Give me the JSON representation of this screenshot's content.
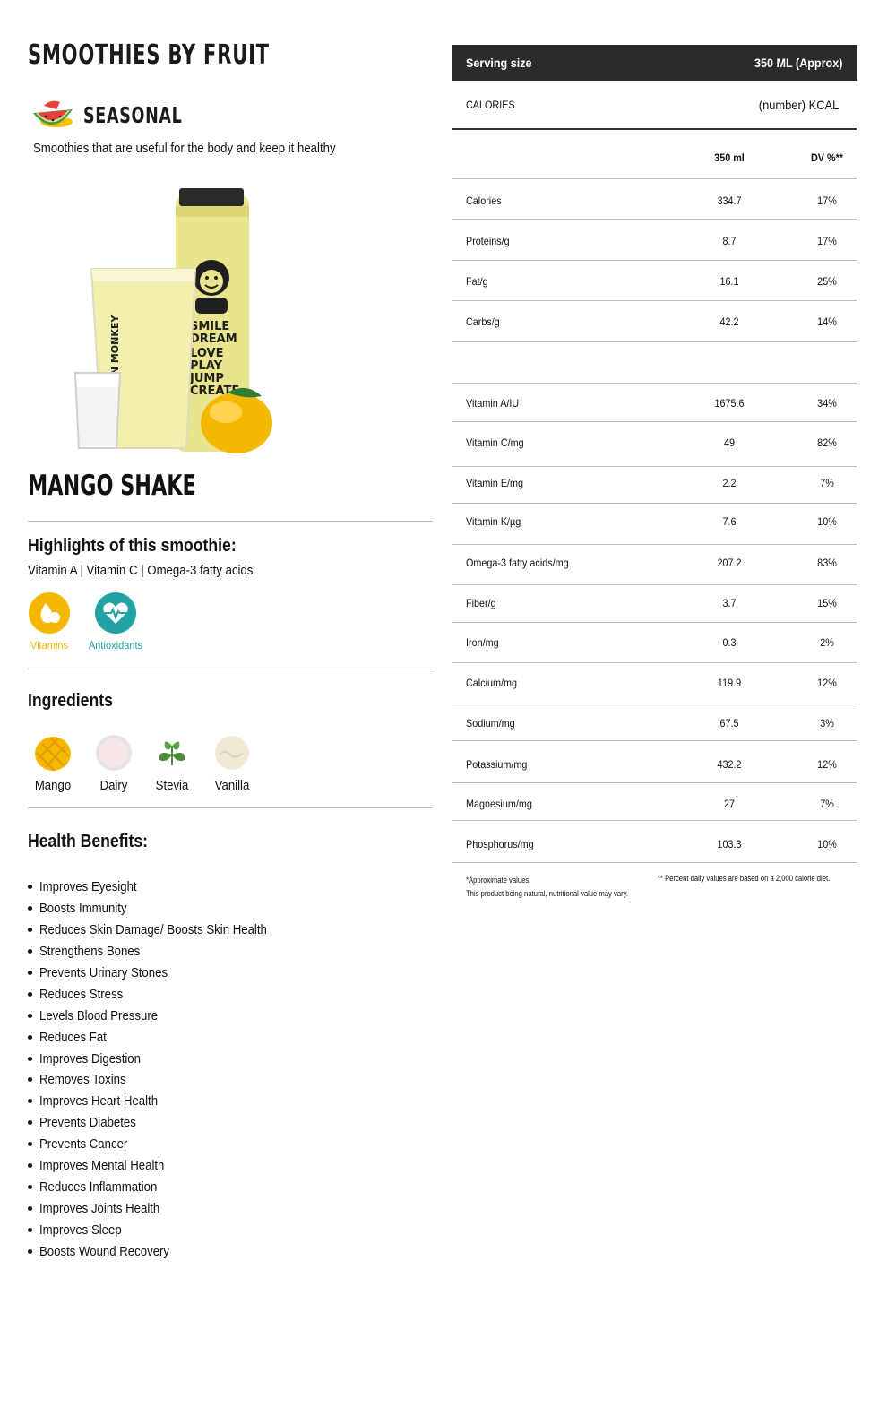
{
  "header": {
    "title": "SMOOTHIES BY FRUIT"
  },
  "category": {
    "label": "SEASONAL",
    "icon": "watermelon-icon",
    "description": "Smoothies that are useful for the body and keep it healthy"
  },
  "product": {
    "name": "MANGO SHAKE",
    "image": "mango-shake-bottle-glass-image"
  },
  "highlights": {
    "title": "Highlights of this smoothie:",
    "text": "Vitamin A | Vitamin C | Omega-3 fatty acids",
    "badges": [
      {
        "label": "Vitamins",
        "icon": "pear-drop-icon",
        "color": "#f5b800"
      },
      {
        "label": "Antioxidants",
        "icon": "heart-pulse-icon",
        "color": "#1fa3a3"
      }
    ]
  },
  "ingredients": {
    "title": "Ingredients",
    "items": [
      {
        "label": "Mango",
        "icon": "mango-icon"
      },
      {
        "label": "Dairy",
        "icon": "dairy-icon"
      },
      {
        "label": "Stevia",
        "icon": "stevia-leaf-icon"
      },
      {
        "label": "Vanilla",
        "icon": "vanilla-scoop-icon"
      }
    ]
  },
  "benefits": {
    "title": "Health Benefits:",
    "items": [
      "Improves Eyesight",
      "Boosts Immunity",
      "Reduces Skin Damage/ Boosts Skin Health",
      "Strengthens Bones",
      "Prevents Urinary Stones",
      "Reduces Stress",
      "Levels Blood Pressure",
      "Reduces Fat",
      "Improves Digestion",
      "Removes Toxins",
      "Improves Heart Health",
      "Prevents Diabetes",
      "Prevents Cancer",
      "Improves Mental Health",
      "Reduces Inflammation",
      "Improves Joints Health",
      "Improves Sleep",
      "Boosts Wound Recovery"
    ]
  },
  "nutrition": {
    "serving_label": "Serving size",
    "serving_value": "350 ML (Approx)",
    "calories_label": "CALORIES",
    "calories_value": "(number) KCAL",
    "col_amount": "350 ml",
    "col_dv": "DV %**",
    "macros": [
      {
        "name": "Calories",
        "amount": "334.7",
        "dv": "17%"
      },
      {
        "name": "Proteins/g",
        "amount": "8.7",
        "dv": "17%"
      },
      {
        "name": "Fat/g",
        "amount": "16.1",
        "dv": "25%"
      },
      {
        "name": "Carbs/g",
        "amount": "42.2",
        "dv": "14%"
      }
    ],
    "micros": [
      {
        "name": "Vitamin A/IU",
        "amount": "1675.6",
        "dv": "34%"
      },
      {
        "name": "Vitamin C/mg",
        "amount": "49",
        "dv": "82%"
      },
      {
        "name": "Vitamin E/mg",
        "amount": "2.2",
        "dv": "7%"
      },
      {
        "name": "Vitamin K/µg",
        "amount": "7.6",
        "dv": "10%"
      },
      {
        "name": "Omega-3 fatty acids/mg",
        "amount": "207.2",
        "dv": "83%"
      },
      {
        "name": "Fiber/g",
        "amount": "3.7",
        "dv": "15%"
      },
      {
        "name": "Iron/mg",
        "amount": "0.3",
        "dv": "2%"
      },
      {
        "name": "Calcium/mg",
        "amount": "119.9",
        "dv": "12%"
      },
      {
        "name": "Sodium/mg",
        "amount": "67.5",
        "dv": "3%"
      },
      {
        "name": "Potassium/mg",
        "amount": "432.2",
        "dv": "12%"
      },
      {
        "name": "Magnesium/mg",
        "amount": "27",
        "dv": "7%"
      },
      {
        "name": "Phosphorus/mg",
        "amount": "103.3",
        "dv": "10%"
      }
    ],
    "footnote_left_1": "*Approximate values.",
    "footnote_left_2": "This product being natural, nutritional value may vary.",
    "footnote_right": "** Percent daily values are based on a 2,000 calorie diet."
  }
}
